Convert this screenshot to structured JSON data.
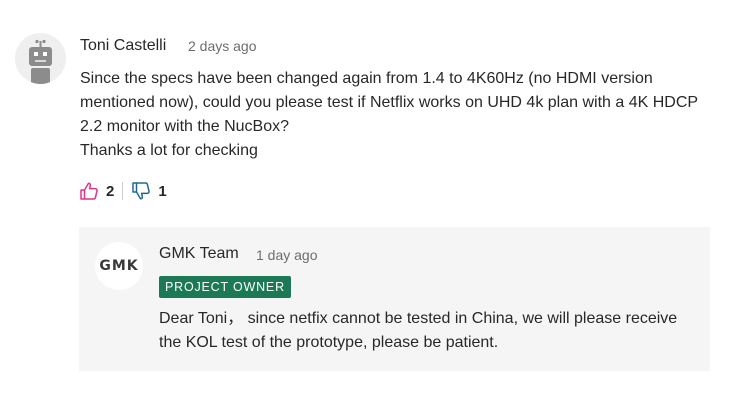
{
  "comment": {
    "author": "Toni Castelli",
    "timestamp": "2 days ago",
    "avatar_icon": "robot-avatar-icon",
    "body_lines": [
      "Since the specs have been changed again from 1.4 to 4K60Hz (no HDMI version mentioned now), could you please test if Netflix works on UHD 4k plan with a 4K HDCP 2.2 monitor with the NucBox?",
      "Thanks a lot for checking"
    ],
    "votes": {
      "up_icon": "thumbs-up-icon",
      "up_count": "2",
      "down_icon": "thumbs-down-icon",
      "down_count": "1"
    }
  },
  "reply": {
    "avatar_text": "GMK",
    "author": "GMK Team",
    "timestamp": "1 day ago",
    "badge": "PROJECT OWNER",
    "body_lines": [
      "Dear Toni， since netfix cannot be tested in China, we will please receive the KOL test of the prototype, please be patient."
    ]
  },
  "colors": {
    "badge_bg": "#1b7a55",
    "upvote_accent": "#e0338c",
    "downvote_accent": "#1f6a8c",
    "reply_bg": "#f5f5f5",
    "meta_text": "#6d6d6d"
  }
}
